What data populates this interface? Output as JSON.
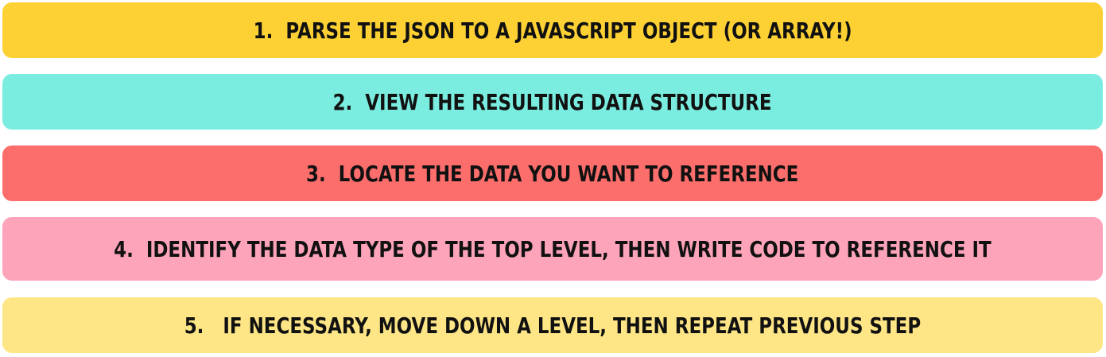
{
  "colors": {
    "step1": "#fdd033",
    "step2": "#7bede0",
    "step3": "#fb6e6c",
    "step4": "#fea4ba",
    "step5": "#fee586"
  },
  "steps": [
    {
      "number": "1.",
      "text": "PARSE THE JSON TO A JAVASCRIPT OBJECT (OR ARRAY!)"
    },
    {
      "number": "2.",
      "text": "VIEW THE RESULTING DATA STRUCTURE"
    },
    {
      "number": "3.",
      "text": "LOCATE THE DATA YOU WANT TO REFERENCE"
    },
    {
      "number": "4.",
      "text": "IDENTIFY THE DATA TYPE OF THE TOP LEVEL, THEN WRITE CODE TO REFERENCE IT"
    },
    {
      "number": "5.",
      "text": "IF NECESSARY, MOVE DOWN A LEVEL, THEN REPEAT PREVIOUS STEP"
    }
  ]
}
